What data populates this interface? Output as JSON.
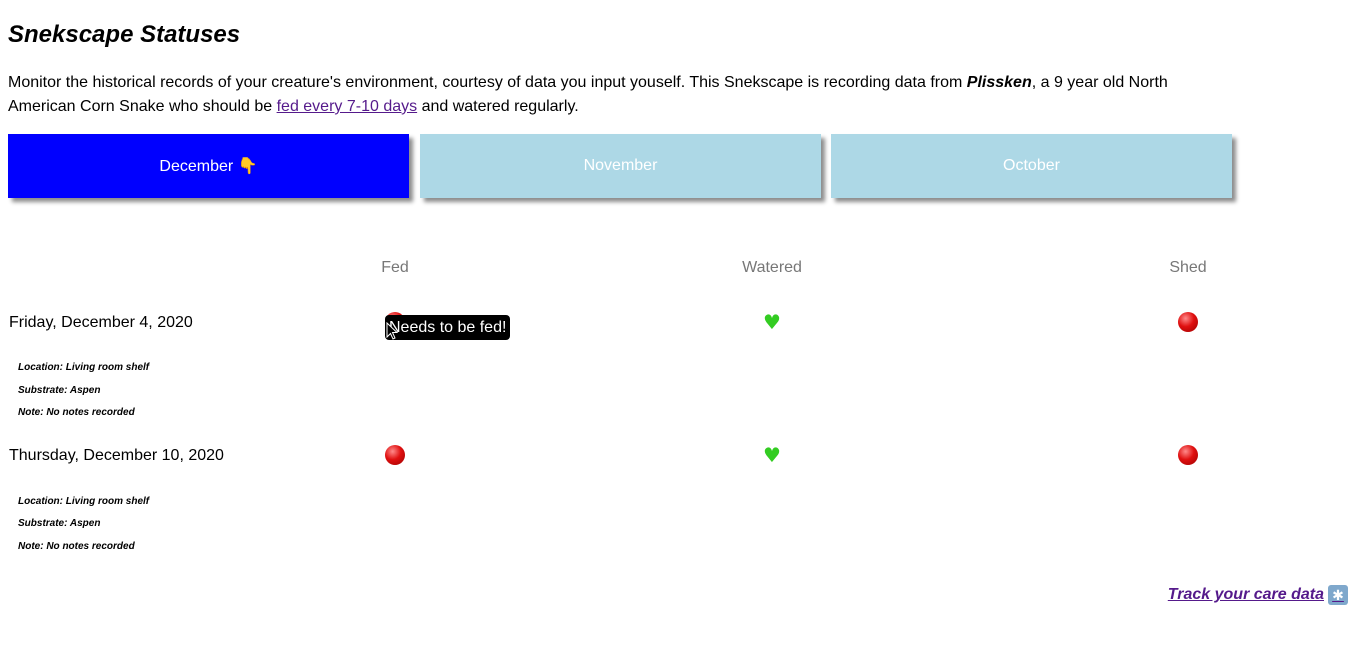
{
  "page": {
    "title": "Snekscape Statuses",
    "intro": {
      "p1": "Monitor the historical records of your creature's environment, courtesy of data you input youself. This Snekscape is recording data from ",
      "snake_name": "Plissken",
      "p2": ", a 9 year old North American Corn Snake who should be ",
      "link_text": "fed every 7-10 days",
      "p3": " and watered regularly."
    }
  },
  "tabs": [
    {
      "label": "December 👇",
      "active": true
    },
    {
      "label": "November",
      "active": false
    },
    {
      "label": "October",
      "active": false
    }
  ],
  "columns": {
    "fed": "Fed",
    "watered": "Watered",
    "shed": "Shed"
  },
  "records": [
    {
      "date": "Friday, December 4, 2020",
      "fed_icon": "red-circle-icon",
      "watered_icon": "green-heart-icon",
      "shed_icon": "red-circle-icon",
      "location": "Location: Living room shelf",
      "substrate": "Substrate: Aspen",
      "note": "Note: No notes recorded"
    },
    {
      "date": "Thursday, December 10, 2020",
      "fed_icon": "red-circle-icon",
      "watered_icon": "green-heart-icon",
      "shed_icon": "red-circle-icon",
      "location": "Location: Living room shelf",
      "substrate": "Substrate: Aspen",
      "note": "Note: No notes recorded"
    }
  ],
  "tooltip": "Needs to be fed!",
  "footer": {
    "track_link": "Track your care data",
    "track_icon": "snowflake-icon"
  },
  "colors": {
    "active_tab": "#0000ff",
    "inactive_tab": "#add8e6",
    "link": "#551a8b"
  }
}
